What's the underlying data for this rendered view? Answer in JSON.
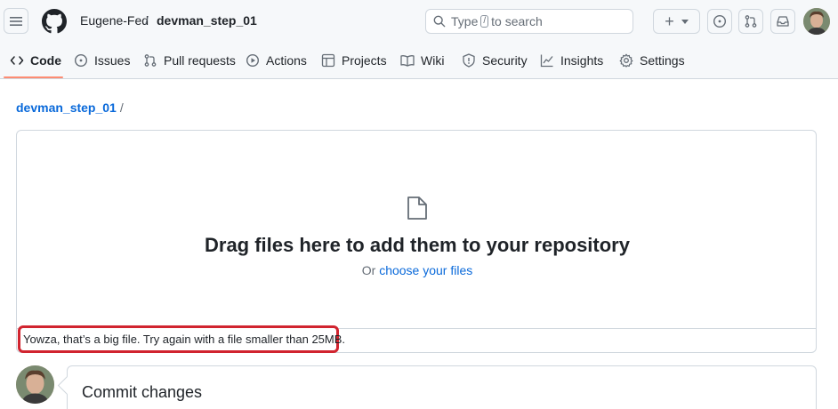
{
  "header": {
    "owner": "Eugene-Fed",
    "separator": "/",
    "repo": "devman_step_01",
    "search_placeholder_before": "Type",
    "search_key": "/",
    "search_placeholder_after": "to search",
    "plus_label": "+"
  },
  "tabs": [
    {
      "label": "Code",
      "icon": "code-icon"
    },
    {
      "label": "Issues",
      "icon": "issue-opened-icon"
    },
    {
      "label": "Pull requests",
      "icon": "git-pull-request-icon"
    },
    {
      "label": "Actions",
      "icon": "play-icon"
    },
    {
      "label": "Projects",
      "icon": "table-icon"
    },
    {
      "label": "Wiki",
      "icon": "book-icon"
    },
    {
      "label": "Security",
      "icon": "shield-icon"
    },
    {
      "label": "Insights",
      "icon": "graph-icon"
    },
    {
      "label": "Settings",
      "icon": "gear-icon"
    }
  ],
  "breadcrumb": {
    "repo": "devman_step_01",
    "slash": "/"
  },
  "dropzone": {
    "title": "Drag files here to add them to your repository",
    "sub_prefix": "Or",
    "sub_link": "choose your files",
    "error": "Yowza, that’s a big file. Try again with a file smaller than 25MB."
  },
  "commit": {
    "title": "Commit changes"
  },
  "colors": {
    "accent_link": "#0969da",
    "tab_underline": "#fd8c73",
    "error_outline": "#d1242f"
  }
}
